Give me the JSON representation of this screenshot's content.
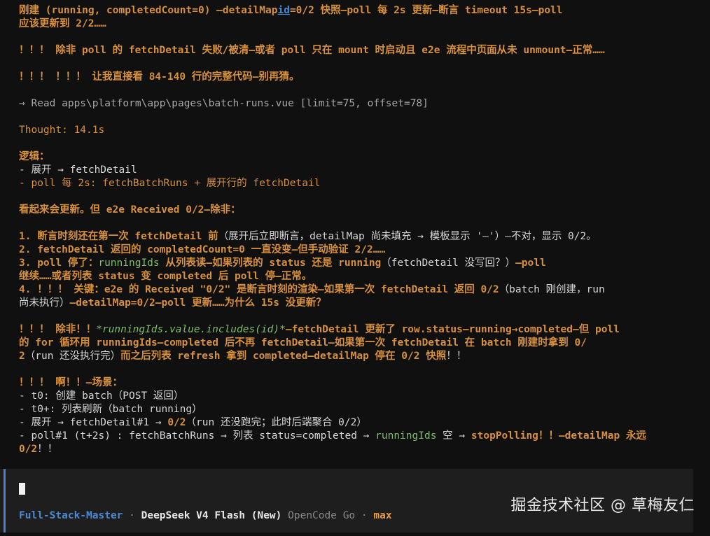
{
  "transcript": {
    "l1": {
      "a": "刚建 (running, completedCount=0) —detailMap",
      "link": "id",
      "b": "=0/2 快照—poll 每 2s 更新—断言 timeout 15s—poll"
    },
    "l2": "应该更新到 2/2……",
    "l3": "！！！ 除非 poll 的 fetchDetail 失败/被清—或者 poll 只在 mount 时启动且 e2e 流程中页面从未 unmount—正常……",
    "l4": "！！！ ！！！ 让我直接看 84-140 行的完整代码—别再猜。",
    "tool": "→ Read apps\\platform\\app\\pages\\batch-runs.vue [limit=75, offset=78]",
    "thought": "Thought: 14.1s",
    "logic_title": "逻辑：",
    "logic_1": "- 展开 → fetchDetail",
    "logic_2": "- poll 每 2s: fetchBatchRuns + 展开行的 fetchDetail",
    "seems": "看起来会更新。但 e2e Received 0/2—除非：",
    "p1": {
      "a": "1. 断言时刻还在第一次 fetchDetail 前",
      "b": "（展开后立即断言，detailMap 尚未填充 → 模板显示 '—'）—不对，显示 0/2。"
    },
    "p2": {
      "a": "2. fetchDetail 返回的 completedCount=0 一直没变—但手动验证 2/2……"
    },
    "p3": {
      "a": "3. poll 停了：",
      "b": "runningIds",
      "c": " 从列表读—如果列表的 status 还是 running",
      "d": "（fetchDetail 没写回？）",
      "e": "—poll",
      "f": "继续……或者列表 status 变 completed 后 poll 停—正常。"
    },
    "p4": {
      "a": "4. ！！！ 关键：e2e 的 Received \"0/2\" 是断言时刻的渲染—如果第一次 fetchDetail 返回 0/2",
      "b": "（batch 刚创建，run",
      "c": "尚未执行）",
      "d": "—detailMap=0/2—poll 更新……为什么 15s 没更新？"
    },
    "q1": {
      "a": "！！！ 除非！！",
      "b": "*runningIds.value.includes(id)*",
      "c": "—fetchDetail 更新了 row.status—running→completed—但 poll",
      "d": "的 for 循环用 runningIds—completed 后不再 fetchDetail—如果第一次 fetchDetail 在 batch 刚建时拿到 0/",
      "e": "2",
      "f": "（run 还没执行完）",
      "g": "而之后列表 refresh 拿到 completed—detailMap 停在 0/2 快照",
      "h": "！！"
    },
    "s_title": "！！！ 啊！！—场景：",
    "s1": "- t0: 创建 batch（POST 返回）",
    "s2": "- t0+: 列表刷新（batch running）",
    "s3": {
      "a": "- 展开 → fetchDetail#1 → ",
      "b": "0/2",
      "c": "（run 还没跑完；此时后端聚合 0/2）"
    },
    "s4": {
      "a": "- poll#1 (t+2s) : fetchBatchRuns → 列表 status=completed → ",
      "b": "runningIds",
      "c": " 空 → ",
      "d": "stopPolling",
      "e": "！！—detailMap 永远",
      "f": "0/2",
      "g": "！！"
    }
  },
  "status_bar": {
    "agent": "Full-Stack-Master",
    "sep1": " · ",
    "model": "DeepSeek V4 Flash (New)",
    "provider": " OpenCode Go",
    "sep2": " · ",
    "variant": "max"
  },
  "watermark": "掘金技术社区 @ 草梅友仁",
  "colors": {
    "accent_orange": "#d7903e",
    "accent_green": "#7ebd6a",
    "agent_blue": "#4d88d1",
    "background": "#101010",
    "prompt_bg": "#1e1e1e"
  }
}
